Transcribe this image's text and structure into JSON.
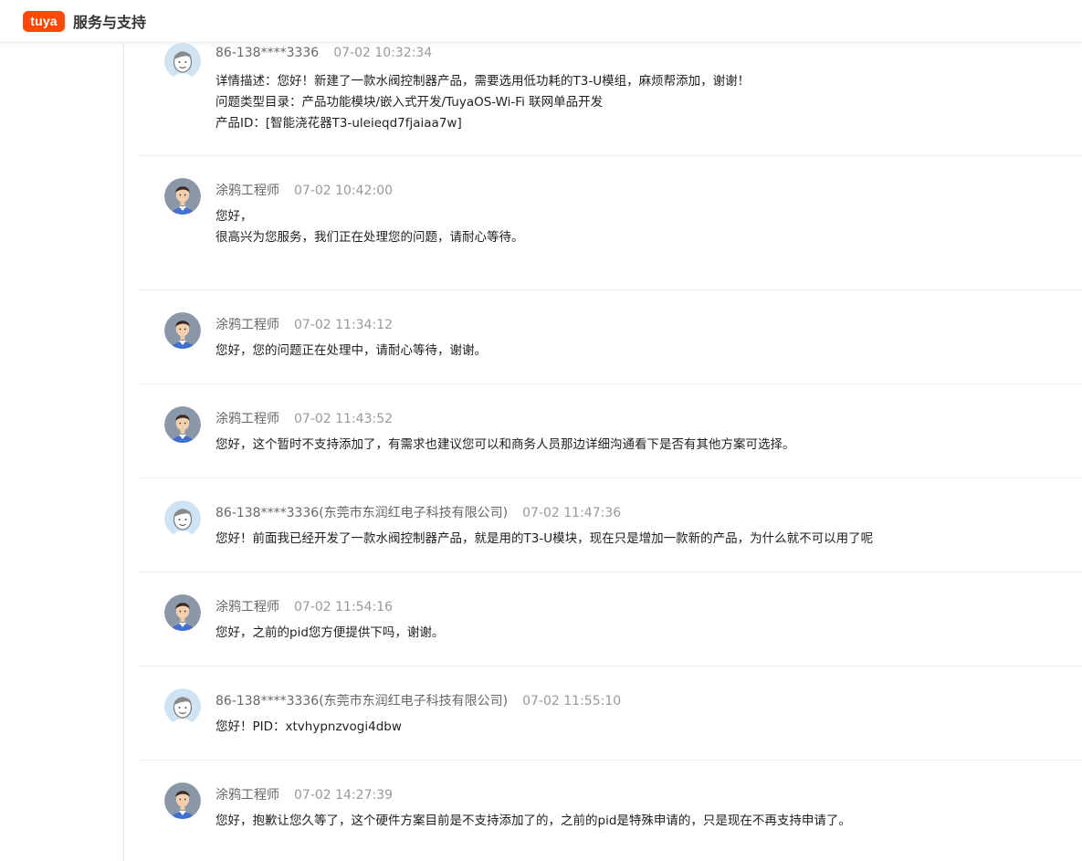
{
  "header": {
    "logo_text": "tuya",
    "title": "服务与支持",
    "brand_color": "#ff4800"
  },
  "messages": [
    {
      "type": "user",
      "sender": "86-138****3336",
      "time": "07-02 10:32:34",
      "lines": [
        "详情描述：您好！新建了一款水阀控制器产品，需要选用低功耗的T3-U模组，麻烦帮添加，谢谢！",
        "问题类型目录：产品功能模块/嵌入式开发/TuyaOS-Wi-Fi 联网单品开发",
        "产品ID：[智能浇花器T3-uleieqd7fjaiaa7w]"
      ]
    },
    {
      "type": "engineer",
      "sender": "涂鸦工程师",
      "time": "07-02 10:42:00",
      "lines": [
        "您好，",
        "很高兴为您服务，我们正在处理您的问题，请耐心等待。"
      ]
    },
    {
      "type": "engineer",
      "sender": "涂鸦工程师",
      "time": "07-02 11:34:12",
      "lines": [
        "您好，您的问题正在处理中，请耐心等待，谢谢。"
      ]
    },
    {
      "type": "engineer",
      "sender": "涂鸦工程师",
      "time": "07-02 11:43:52",
      "lines": [
        "您好，这个暂时不支持添加了，有需求也建议您可以和商务人员那边详细沟通看下是否有其他方案可选择。"
      ]
    },
    {
      "type": "user",
      "sender": "86-138****3336(东莞市东润红电子科技有限公司)",
      "time": "07-02 11:47:36",
      "lines": [
        "您好！前面我已经开发了一款水阀控制器产品，就是用的T3-U模块，现在只是增加一款新的产品，为什么就不可以用了呢"
      ]
    },
    {
      "type": "engineer",
      "sender": "涂鸦工程师",
      "time": "07-02 11:54:16",
      "lines": [
        "您好，之前的pid您方便提供下吗，谢谢。"
      ]
    },
    {
      "type": "user",
      "sender": "86-138****3336(东莞市东润红电子科技有限公司)",
      "time": "07-02 11:55:10",
      "lines": [
        "您好！PID：xtvhypnzvogi4dbw"
      ]
    },
    {
      "type": "engineer",
      "sender": "涂鸦工程师",
      "time": "07-02 14:27:39",
      "lines": [
        "您好，抱歉让您久等了，这个硬件方案目前是不支持添加了的，之前的pid是特殊申请的，只是现在不再支持申请了。"
      ]
    }
  ]
}
